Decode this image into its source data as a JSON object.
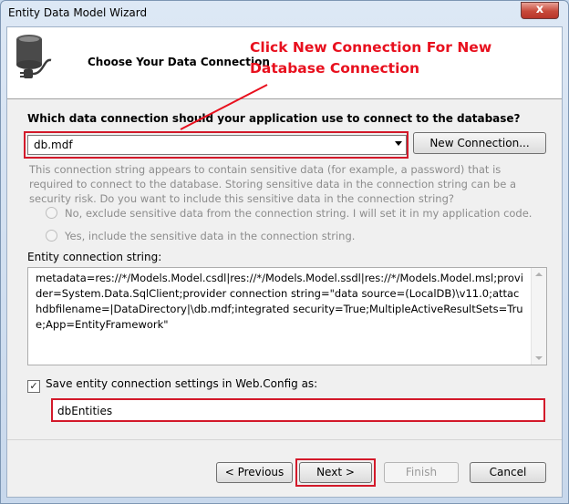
{
  "window": {
    "title": "Entity Data Model Wizard",
    "close_glyph": "x"
  },
  "header": {
    "title": "Choose Your Data Connection",
    "icon": "database-plug-icon",
    "annotation": "Click New Connection For New Database Connection"
  },
  "connection": {
    "question": "Which data connection should your application use to connect to the database?",
    "selected": "db.mdf",
    "new_connection_label": "New Connection..."
  },
  "sensitive": {
    "note": "This connection string appears to contain sensitive data (for example, a password) that is required to connect to the database. Storing sensitive data in the connection string can be a security risk. Do you want to include this sensitive data in the connection string?",
    "option_exclude": "No, exclude sensitive data from the connection string. I will set it in my application code.",
    "option_include": "Yes, include the sensitive data in the connection string."
  },
  "entity_connection": {
    "label": "Entity connection string:",
    "value": "metadata=res://*/Models.Model.csdl|res://*/Models.Model.ssdl|res://*/Models.Model.msl;provider=System.Data.SqlClient;provider connection string=\"data source=(LocalDB)\\v11.0;attachdbfilename=|DataDirectory|\\db.mdf;integrated security=True;MultipleActiveResultSets=True;App=EntityFramework\""
  },
  "save_settings": {
    "label": "Save entity connection settings in Web.Config as:",
    "checked": true,
    "value": "dbEntities"
  },
  "buttons": {
    "previous": "< Previous",
    "next": "Next >",
    "finish": "Finish",
    "cancel": "Cancel"
  },
  "colors": {
    "annotation_red": "#e8101e",
    "highlight_red": "#d3192a"
  }
}
